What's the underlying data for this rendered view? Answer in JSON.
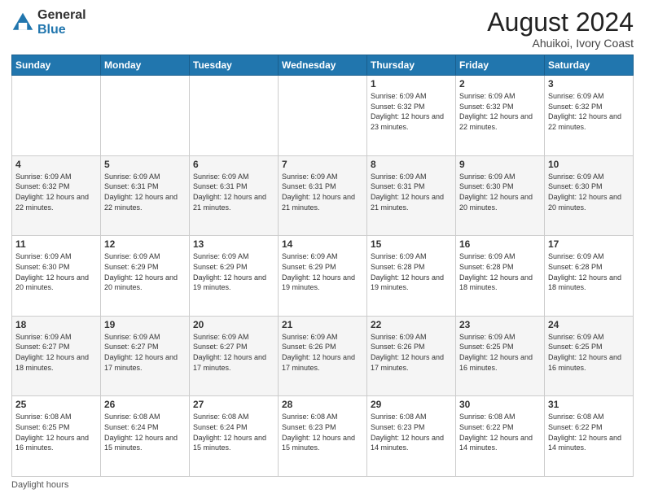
{
  "header": {
    "logo_general": "General",
    "logo_blue": "Blue",
    "title": "August 2024",
    "location": "Ahuikoi, Ivory Coast"
  },
  "days_of_week": [
    "Sunday",
    "Monday",
    "Tuesday",
    "Wednesday",
    "Thursday",
    "Friday",
    "Saturday"
  ],
  "weeks": [
    [
      {
        "day": "",
        "info": ""
      },
      {
        "day": "",
        "info": ""
      },
      {
        "day": "",
        "info": ""
      },
      {
        "day": "",
        "info": ""
      },
      {
        "day": "1",
        "info": "Sunrise: 6:09 AM\nSunset: 6:32 PM\nDaylight: 12 hours and 23 minutes."
      },
      {
        "day": "2",
        "info": "Sunrise: 6:09 AM\nSunset: 6:32 PM\nDaylight: 12 hours and 22 minutes."
      },
      {
        "day": "3",
        "info": "Sunrise: 6:09 AM\nSunset: 6:32 PM\nDaylight: 12 hours and 22 minutes."
      }
    ],
    [
      {
        "day": "4",
        "info": "Sunrise: 6:09 AM\nSunset: 6:32 PM\nDaylight: 12 hours and 22 minutes."
      },
      {
        "day": "5",
        "info": "Sunrise: 6:09 AM\nSunset: 6:31 PM\nDaylight: 12 hours and 22 minutes."
      },
      {
        "day": "6",
        "info": "Sunrise: 6:09 AM\nSunset: 6:31 PM\nDaylight: 12 hours and 21 minutes."
      },
      {
        "day": "7",
        "info": "Sunrise: 6:09 AM\nSunset: 6:31 PM\nDaylight: 12 hours and 21 minutes."
      },
      {
        "day": "8",
        "info": "Sunrise: 6:09 AM\nSunset: 6:31 PM\nDaylight: 12 hours and 21 minutes."
      },
      {
        "day": "9",
        "info": "Sunrise: 6:09 AM\nSunset: 6:30 PM\nDaylight: 12 hours and 20 minutes."
      },
      {
        "day": "10",
        "info": "Sunrise: 6:09 AM\nSunset: 6:30 PM\nDaylight: 12 hours and 20 minutes."
      }
    ],
    [
      {
        "day": "11",
        "info": "Sunrise: 6:09 AM\nSunset: 6:30 PM\nDaylight: 12 hours and 20 minutes."
      },
      {
        "day": "12",
        "info": "Sunrise: 6:09 AM\nSunset: 6:29 PM\nDaylight: 12 hours and 20 minutes."
      },
      {
        "day": "13",
        "info": "Sunrise: 6:09 AM\nSunset: 6:29 PM\nDaylight: 12 hours and 19 minutes."
      },
      {
        "day": "14",
        "info": "Sunrise: 6:09 AM\nSunset: 6:29 PM\nDaylight: 12 hours and 19 minutes."
      },
      {
        "day": "15",
        "info": "Sunrise: 6:09 AM\nSunset: 6:28 PM\nDaylight: 12 hours and 19 minutes."
      },
      {
        "day": "16",
        "info": "Sunrise: 6:09 AM\nSunset: 6:28 PM\nDaylight: 12 hours and 18 minutes."
      },
      {
        "day": "17",
        "info": "Sunrise: 6:09 AM\nSunset: 6:28 PM\nDaylight: 12 hours and 18 minutes."
      }
    ],
    [
      {
        "day": "18",
        "info": "Sunrise: 6:09 AM\nSunset: 6:27 PM\nDaylight: 12 hours and 18 minutes."
      },
      {
        "day": "19",
        "info": "Sunrise: 6:09 AM\nSunset: 6:27 PM\nDaylight: 12 hours and 17 minutes."
      },
      {
        "day": "20",
        "info": "Sunrise: 6:09 AM\nSunset: 6:27 PM\nDaylight: 12 hours and 17 minutes."
      },
      {
        "day": "21",
        "info": "Sunrise: 6:09 AM\nSunset: 6:26 PM\nDaylight: 12 hours and 17 minutes."
      },
      {
        "day": "22",
        "info": "Sunrise: 6:09 AM\nSunset: 6:26 PM\nDaylight: 12 hours and 17 minutes."
      },
      {
        "day": "23",
        "info": "Sunrise: 6:09 AM\nSunset: 6:25 PM\nDaylight: 12 hours and 16 minutes."
      },
      {
        "day": "24",
        "info": "Sunrise: 6:09 AM\nSunset: 6:25 PM\nDaylight: 12 hours and 16 minutes."
      }
    ],
    [
      {
        "day": "25",
        "info": "Sunrise: 6:08 AM\nSunset: 6:25 PM\nDaylight: 12 hours and 16 minutes."
      },
      {
        "day": "26",
        "info": "Sunrise: 6:08 AM\nSunset: 6:24 PM\nDaylight: 12 hours and 15 minutes."
      },
      {
        "day": "27",
        "info": "Sunrise: 6:08 AM\nSunset: 6:24 PM\nDaylight: 12 hours and 15 minutes."
      },
      {
        "day": "28",
        "info": "Sunrise: 6:08 AM\nSunset: 6:23 PM\nDaylight: 12 hours and 15 minutes."
      },
      {
        "day": "29",
        "info": "Sunrise: 6:08 AM\nSunset: 6:23 PM\nDaylight: 12 hours and 14 minutes."
      },
      {
        "day": "30",
        "info": "Sunrise: 6:08 AM\nSunset: 6:22 PM\nDaylight: 12 hours and 14 minutes."
      },
      {
        "day": "31",
        "info": "Sunrise: 6:08 AM\nSunset: 6:22 PM\nDaylight: 12 hours and 14 minutes."
      }
    ]
  ],
  "footer": {
    "daylight_label": "Daylight hours"
  }
}
